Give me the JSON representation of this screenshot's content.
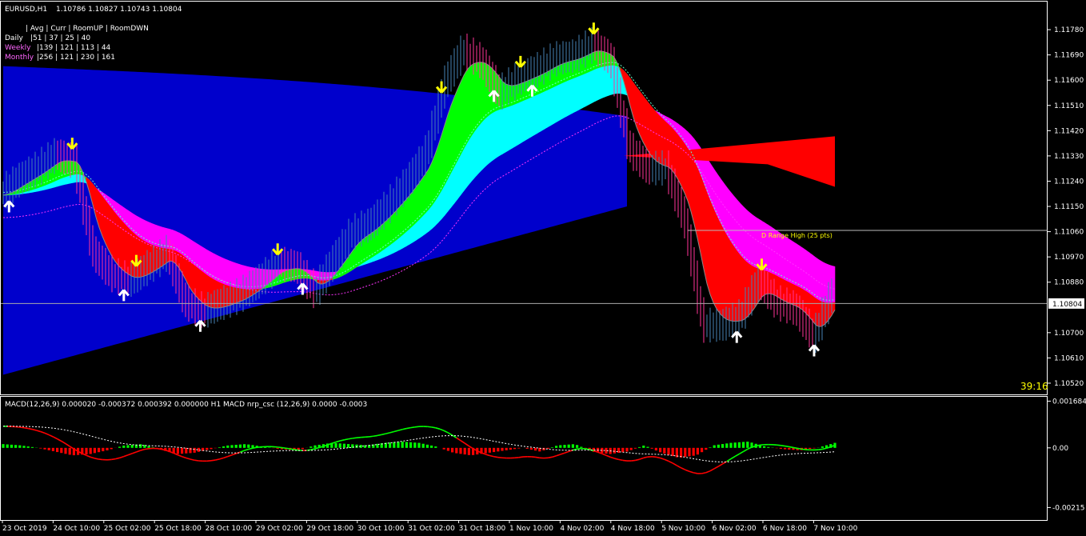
{
  "header": {
    "symbol": "EURUSD,H1",
    "ohlc": "1.10786 1.10827 1.10743 1.10804"
  },
  "info_table": {
    "header": "| Avg | Curr | RoomUP | RoomDWN",
    "rows": [
      {
        "label": "Daily",
        "values": "|51 | 37 | 25 | 40",
        "color": "#ffffff"
      },
      {
        "label": "Weekly",
        "values": "|139 | 121 | 113 | 44",
        "color": "#ff66ff"
      },
      {
        "label": "Monthly",
        "values": "|256 | 121 | 230 | 161",
        "color": "#ff66ff"
      }
    ]
  },
  "range_label": "D Range High (25 pts)",
  "timer": "39:16",
  "current_price": "1.10804",
  "colors": {
    "bull": "#00ff00",
    "bear": "#ff0000",
    "magenta": "#ff00ff",
    "cyan": "#00ffff",
    "blue": "#0000cc",
    "candle_up": "#4682b4",
    "candle_down": "#ff3399",
    "arrow_up": "#ffffff",
    "arrow_down": "#ffff00"
  },
  "chart_data": [
    {
      "type": "line",
      "panel": "price",
      "ylim": [
        1.1048,
        1.1188
      ],
      "y_ticks": [
        "1.11780",
        "1.11690",
        "1.11600",
        "1.11510",
        "1.11420",
        "1.11330",
        "1.11240",
        "1.11150",
        "1.11060",
        "1.10970",
        "1.10880",
        "1.10700",
        "1.10610",
        "1.10520"
      ],
      "current_price": 1.10804,
      "series": [
        {
          "values": [
            1.1119,
            1.1124,
            1.1128,
            1.1133,
            1.113,
            1.1098,
            1.109,
            1.1088,
            1.1093,
            1.1098,
            1.108,
            1.1077,
            1.108,
            1.1083,
            1.1088,
            1.1094,
            1.1093,
            1.1084,
            1.1095,
            1.1105,
            1.1108,
            1.1115,
            1.1123,
            1.1133,
            1.1158,
            1.117,
            1.1166,
            1.1155,
            1.116,
            1.1163,
            1.1167,
            1.1168,
            1.1172,
            1.1167,
            1.1135,
            1.1128,
            1.1128,
            1.111,
            1.1072,
            1.1072,
            1.1075,
            1.1088,
            1.108,
            1.1078,
            1.1068,
            1.1084
          ]
        }
      ]
    },
    {
      "type": "bar",
      "panel": "indicator",
      "title": "MACD(12,26,9) 0.000020 -0.000372 0.000392 0.000000  H1 MACD nrp_csc (12,26,9) 0.0000 -0.0003",
      "ylim": [
        -0.0026,
        0.00184
      ],
      "y_ticks": [
        "0.001684",
        "0.00",
        "-0.00215"
      ],
      "values": [
        0.0003,
        0.0002,
        0.0,
        -0.0003,
        -0.0006,
        -0.0005,
        -0.0002,
        0.0002,
        0.0003,
        -0.0001,
        -0.0005,
        -0.0004,
        -0.0001,
        0.0002,
        0.0003,
        0.0001,
        -0.0001,
        -0.0002,
        0.0002,
        0.0004,
        0.0003,
        0.0002,
        0.0004,
        0.0005,
        0.0004,
        0.0001,
        -0.0004,
        -0.0006,
        -0.0004,
        -0.0002,
        0.0,
        -0.0003,
        0.0002,
        0.0003,
        -0.0003,
        -0.0005,
        -0.0003,
        0.0002,
        -0.0004,
        -0.0008,
        -0.0006,
        0.0002,
        0.0004,
        0.0005,
        0.0001,
        -0.0001,
        -0.0002,
        0.0,
        0.0004
      ]
    }
  ],
  "x_labels": [
    "23 Oct 2019",
    "24 Oct 10:00",
    "25 Oct 02:00",
    "25 Oct 18:00",
    "28 Oct 10:00",
    "29 Oct 02:00",
    "29 Oct 18:00",
    "30 Oct 10:00",
    "31 Oct 02:00",
    "31 Oct 18:00",
    "1 Nov 10:00",
    "4 Nov 02:00",
    "4 Nov 18:00",
    "5 Nov 10:00",
    "6 Nov 02:00",
    "6 Nov 18:00",
    "7 Nov 10:00"
  ]
}
